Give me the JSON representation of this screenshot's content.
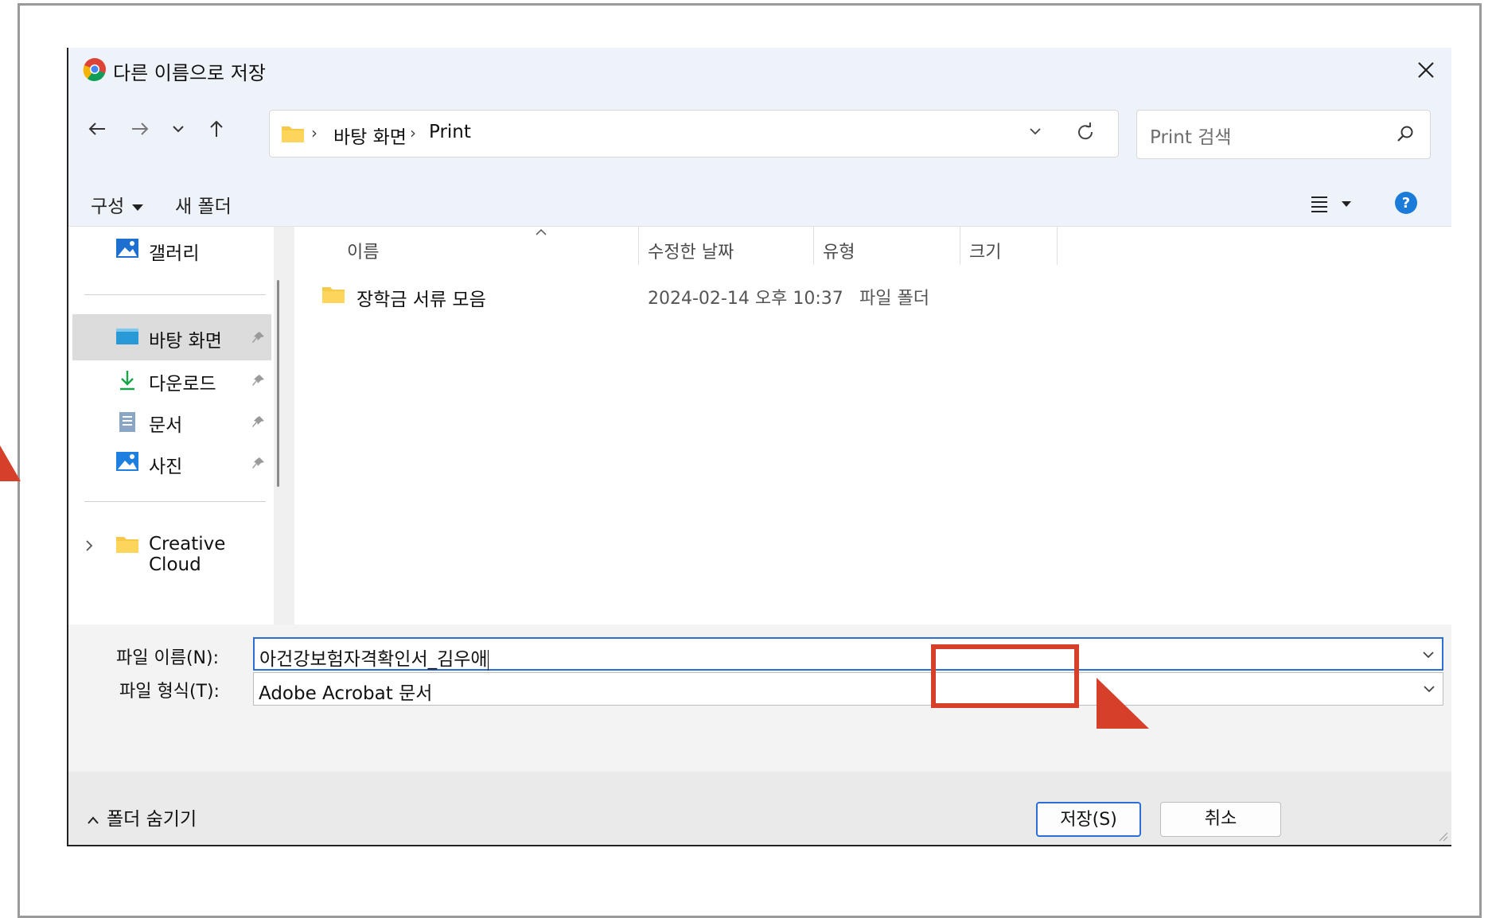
{
  "window": {
    "title": "다른 이름으로 저장"
  },
  "nav": {
    "breadcrumb": [
      "바탕 화면",
      "Print"
    ],
    "search_placeholder": "Print 검색"
  },
  "toolbar": {
    "organize": "구성",
    "new_folder": "새 폴더"
  },
  "sidebar": {
    "items": [
      {
        "label": "갤러리",
        "icon": "gallery-icon"
      },
      {
        "label": "바탕 화면",
        "icon": "desktop-icon",
        "pinned": true,
        "selected": true
      },
      {
        "label": "다운로드",
        "icon": "download-icon",
        "pinned": true
      },
      {
        "label": "문서",
        "icon": "document-icon",
        "pinned": true
      },
      {
        "label": "사진",
        "icon": "pictures-icon",
        "pinned": true
      },
      {
        "label": "Creative Cloud",
        "icon": "folder-icon"
      }
    ]
  },
  "columns": {
    "name": "이름",
    "date": "수정한 날짜",
    "type": "유형",
    "size": "크기"
  },
  "files": [
    {
      "name": "장학금 서류 모음",
      "date": "2024-02-14 오후 10:37",
      "type": "파일 폴더"
    }
  ],
  "form": {
    "filename_label": "파일 이름(N):",
    "filename_value": "아건강보험자격확인서_김우애",
    "filetype_label": "파일 형식(T):",
    "filetype_value": "Adobe Acrobat 문서"
  },
  "footer": {
    "hide_folders": "폴더 숨기기",
    "save": "저장(S)",
    "cancel": "취소"
  },
  "colors": {
    "accent": "#2b6fd6",
    "highlight": "#d6402a",
    "header_bg": "#eef3fa"
  }
}
